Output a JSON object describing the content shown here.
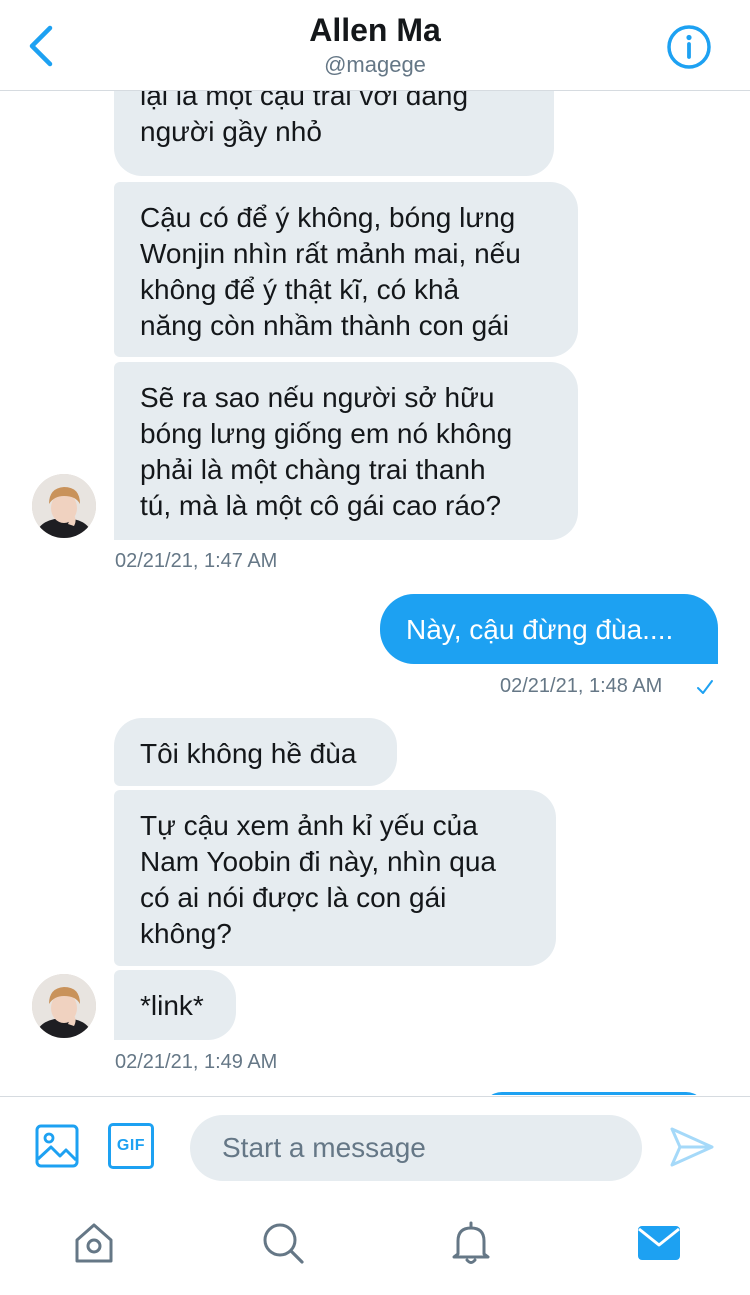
{
  "header": {
    "name": "Allen Ma",
    "handle": "@magege",
    "back_icon": "chevron-left-icon",
    "info_icon": "info-icon",
    "accent": "#1da1f2"
  },
  "messages": [
    {
      "direction": "in",
      "lines": [
        "lại là một cậu trai với dáng",
        "người gầy nhỏ"
      ]
    },
    {
      "direction": "in",
      "lines": [
        "Cậu có để ý không, bóng lưng",
        "Wonjin nhìn rất mảnh mai, nếu",
        "không để ý thật kĩ, có khả",
        "năng còn nhầm thành con gái"
      ]
    },
    {
      "direction": "in",
      "lines": [
        "Sẽ ra sao nếu người sở hữu",
        "bóng lưng giống em nó không",
        "phải là một chàng trai thanh",
        "tú, mà là một cô gái cao ráo?"
      ]
    },
    {
      "direction": "out",
      "lines": [
        "Này, cậu đừng đùa...."
      ]
    },
    {
      "direction": "in",
      "lines": [
        "Tôi không hề đùa"
      ]
    },
    {
      "direction": "in",
      "lines": [
        "Tự cậu xem ảnh kỉ yếu của",
        "Nam Yoobin đi này, nhìn qua",
        "có ai nói được là con gái",
        "không?"
      ]
    },
    {
      "direction": "in",
      "lines": [
        "*link*"
      ]
    }
  ],
  "timestamps": {
    "first": "02/21/21, 1:47 AM",
    "sent": "02/21/21, 1:48 AM",
    "second": "02/21/21, 1:49 AM"
  },
  "read_receipt_icon": "check-icon",
  "composer": {
    "placeholder": "Start a message",
    "value": "",
    "image_icon": "image-icon",
    "gif_label": "GIF",
    "send_icon": "send-icon"
  },
  "tabbar": {
    "items": [
      "home-icon",
      "search-icon",
      "bell-icon",
      "mail-icon"
    ],
    "active": "mail-icon"
  },
  "colors": {
    "incoming_bubble": "#e6ecf0",
    "outgoing_bubble": "#1da1f2",
    "secondary_text": "#657786"
  }
}
